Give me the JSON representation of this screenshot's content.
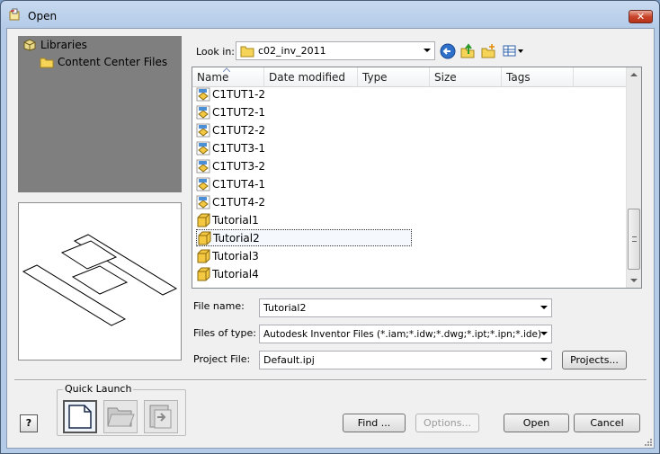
{
  "window": {
    "title": "Open",
    "close_label": "✕"
  },
  "libraries": {
    "root": "Libraries",
    "child": "Content Center Files"
  },
  "lookin": {
    "label": "Look in:",
    "value": "c02_inv_2011"
  },
  "columns": [
    "Name",
    "Date modified",
    "Type",
    "Size",
    "Tags"
  ],
  "files": [
    {
      "name": "C1TUT1-2",
      "icon": "assembly-file-icon"
    },
    {
      "name": "C1TUT2-1",
      "icon": "assembly-file-icon"
    },
    {
      "name": "C1TUT2-2",
      "icon": "assembly-file-icon"
    },
    {
      "name": "C1TUT3-1",
      "icon": "assembly-file-icon"
    },
    {
      "name": "C1TUT3-2",
      "icon": "assembly-file-icon"
    },
    {
      "name": "C1TUT4-1",
      "icon": "assembly-file-icon"
    },
    {
      "name": "C1TUT4-2",
      "icon": "assembly-file-icon"
    },
    {
      "name": "Tutorial1",
      "icon": "part-file-icon"
    },
    {
      "name": "Tutorial2",
      "icon": "part-file-icon",
      "selected": true
    },
    {
      "name": "Tutorial3",
      "icon": "part-file-icon"
    },
    {
      "name": "Tutorial4",
      "icon": "part-file-icon"
    }
  ],
  "filename": {
    "label": "File name:",
    "value": "Tutorial2"
  },
  "filetype": {
    "label": "Files of type:",
    "value": "Autodesk Inventor Files (*.iam;*.idw;*.dwg;*.ipt;*.ipn;*.ide)"
  },
  "project": {
    "label": "Project File:",
    "value": "Default.ipj",
    "button": "Projects..."
  },
  "quick_launch": {
    "label": "Quick Launch"
  },
  "buttons": {
    "find": "Find ...",
    "options": "Options...",
    "open": "Open",
    "cancel": "Cancel",
    "help": "?"
  },
  "colors": {
    "titlebar": "#b4cbe8",
    "selection_border": "#333333",
    "libpane": "#7f7f7f"
  }
}
